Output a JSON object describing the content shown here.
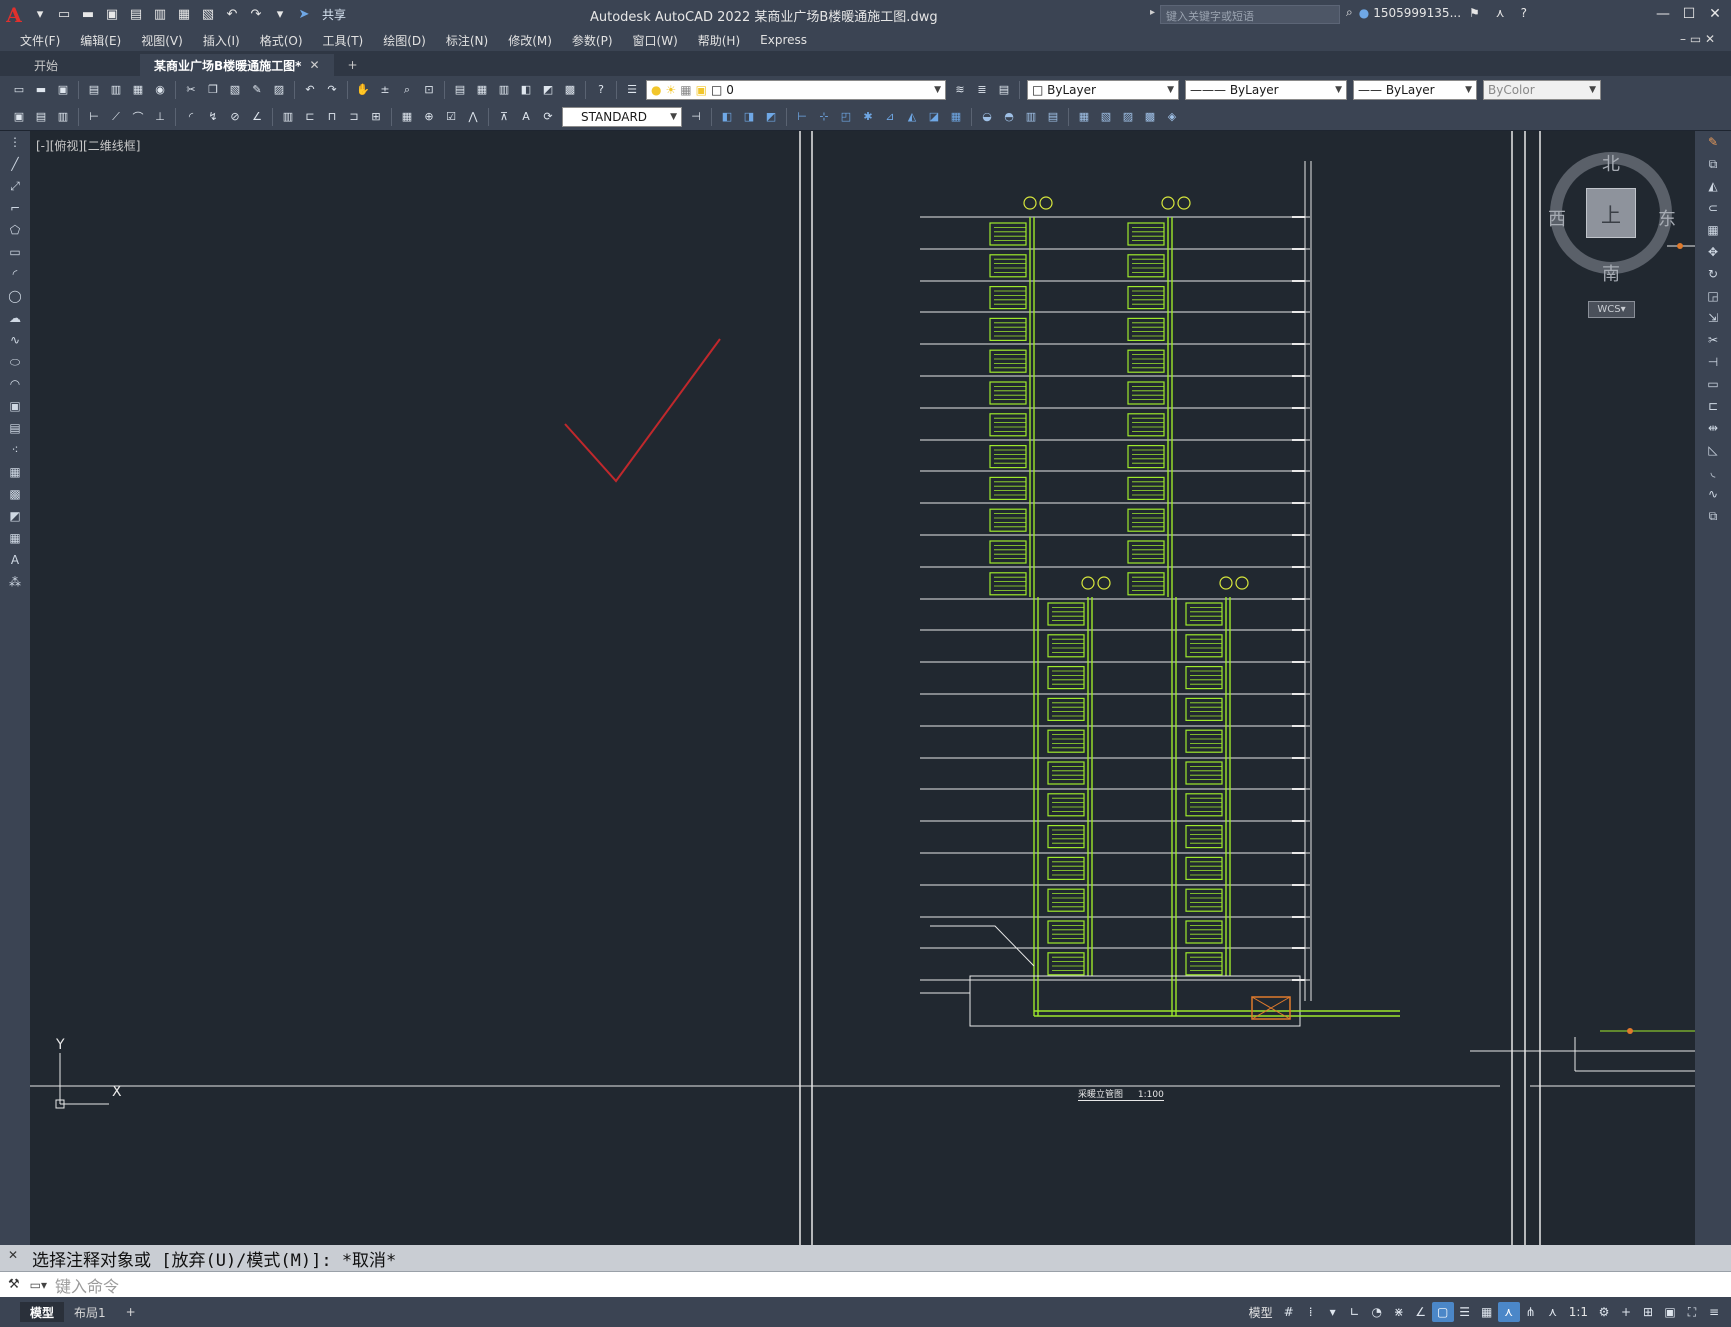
{
  "titlebar": {
    "app_title": "Autodesk AutoCAD 2022",
    "file_title": "某商业广场B楼暖通施工图.dwg",
    "share_label": "共享",
    "search_placeholder": "键入关键字或短语",
    "user": "1505999135..."
  },
  "menu": [
    "文件(F)",
    "编辑(E)",
    "视图(V)",
    "插入(I)",
    "格式(O)",
    "工具(T)",
    "绘图(D)",
    "标注(N)",
    "修改(M)",
    "参数(P)",
    "窗口(W)",
    "帮助(H)",
    "Express"
  ],
  "tabs": {
    "start": "开始",
    "drawing": "某商业广场B楼暖通施工图*"
  },
  "toolbar": {
    "layer_value": "0",
    "color": "ByLayer",
    "linetype": "ByLayer",
    "lineweight": "ByLayer",
    "plotstyle": "ByColor",
    "textstyle": "STANDARD"
  },
  "viewport": {
    "label": "[-][俯视][二维线框]"
  },
  "viewcube": {
    "north": "北",
    "south": "南",
    "east": "东",
    "west": "西",
    "face": "上",
    "wcs": "WCS"
  },
  "drawing": {
    "caption": "采暖立管图",
    "scale": "1:100"
  },
  "command": {
    "history": "选择注释对象或 [放弃(U)/模式(M)]: *取消*",
    "placeholder": "键入命令"
  },
  "layout_tabs": [
    "模型",
    "布局1"
  ],
  "status": {
    "space": "模型",
    "scale": "1:1"
  },
  "colors": {
    "background": "#212830",
    "chrome": "#3b4453",
    "pipe_green": "#9ee82c",
    "annotation_red": "#c0282c",
    "accent_blue": "#4b87c8"
  }
}
